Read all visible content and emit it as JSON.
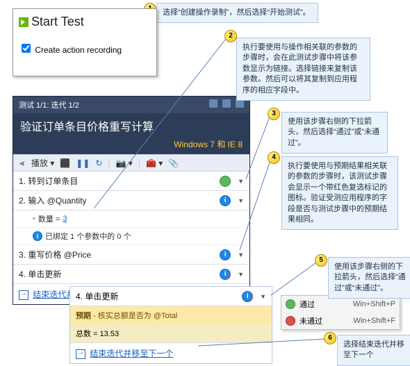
{
  "dialog": {
    "start_label": "Start Test",
    "checkbox_label": "Create action recording"
  },
  "callouts": {
    "c1": "选择“创建操作录制”，然后选择“开始测试”。",
    "c2": "执行要使用与操作相关联的参数的步骤时，会在此测试步骤中将该参数显示为链接。选择链接来复制该参数。然后可以将其复制到应用程序的相应字段中。",
    "c3": "使用该步骤右侧的下拉箭头，然后选择“通过”或“未通过”。",
    "c4": "执行要使用与预期结果相关联的参数的步骤时，该测试步骤会显示一个带红色复选标记的图标。验证受测应用程序的字段是否与测试步骤中的预期结果相同。",
    "c5": "使用该步骤右侧的下拉箭头，然后选择“通过”或“未通过”。",
    "c6": "选择结束迭代并移至下一个"
  },
  "panel": {
    "titlebar": "测试 1/1: 迭代 1/2",
    "title": "验证订单条目价格重写计算",
    "subtitle": "Windows 7 和 IE 8"
  },
  "toolbar": {
    "play_label": "播放"
  },
  "steps": {
    "s1": "1. 转到订单条目",
    "s2": "2. 输入 @Quantity",
    "s2_qty_label": "数量 = ",
    "s2_qty_val": "3",
    "s2_bound": "已绑定 1 个参数中的 0 个",
    "s3": "3. 重写价格 @Price",
    "s4": "4. 单击更新",
    "end_iter": "结束迭代并移至下一个"
  },
  "pop": {
    "step": "4. 单击更新",
    "expected_label": "预期",
    "expected_text": " - 核实总额是否为 @Total",
    "total_label": "总数 = ",
    "total_val": "13.53",
    "end_iter": "结束迭代并移至下一个"
  },
  "menu": {
    "pass": "通过",
    "pass_kb": "Win+Shift+P",
    "fail": "未通过",
    "fail_kb": "Win+Shift+F"
  }
}
